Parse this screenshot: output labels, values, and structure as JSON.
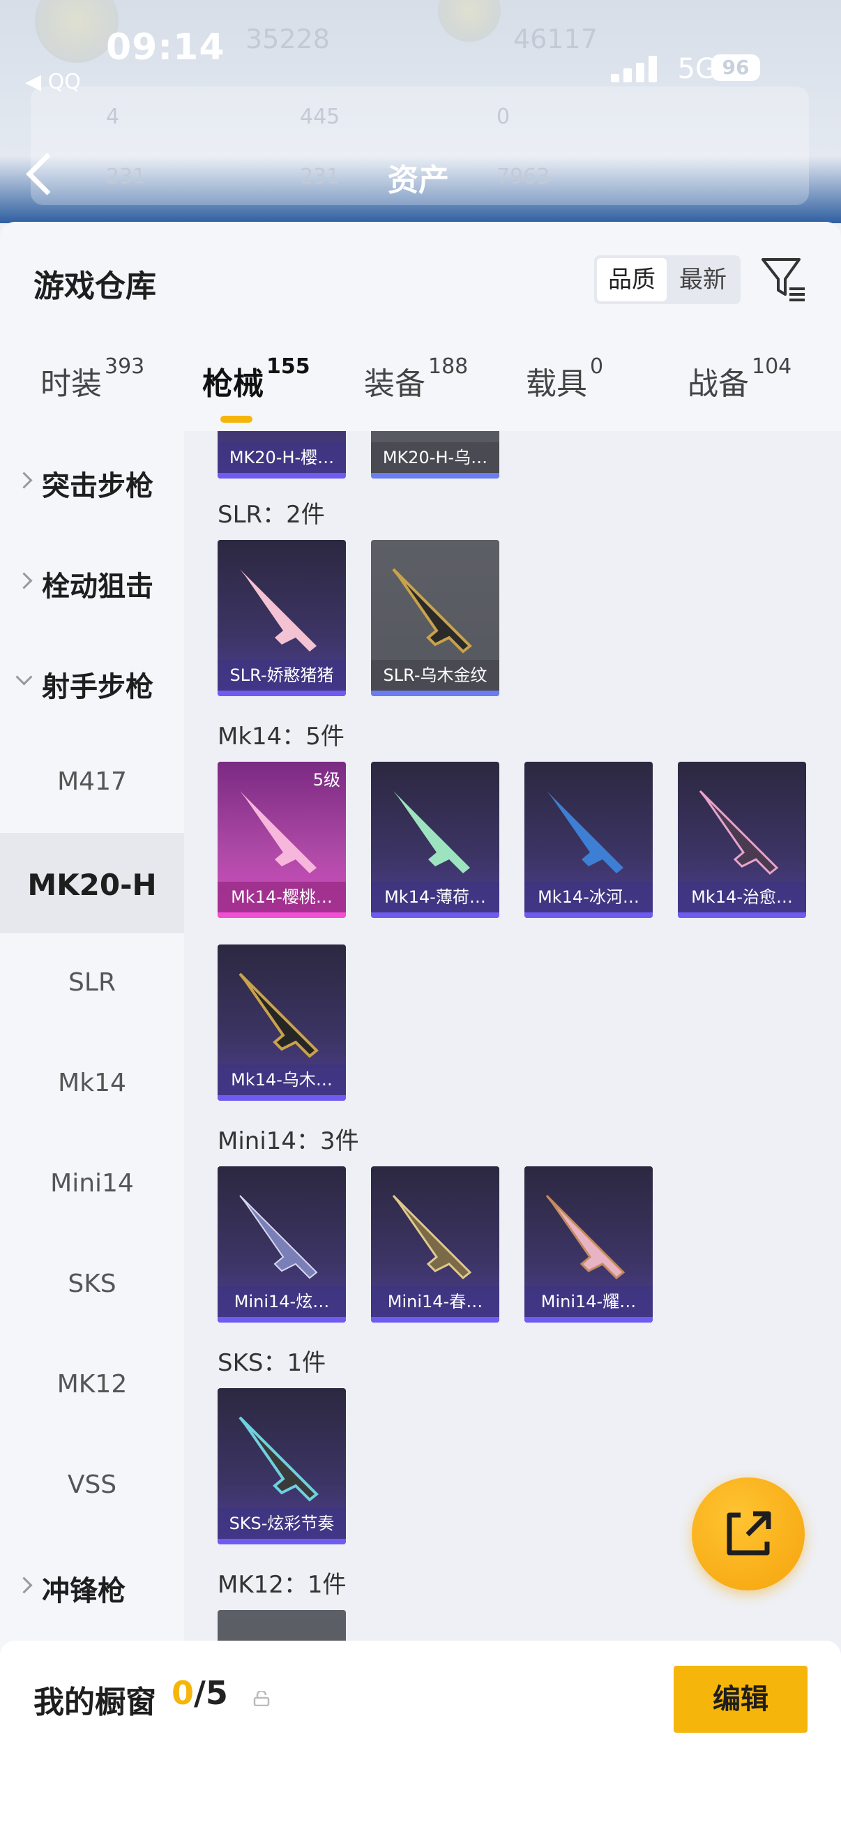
{
  "status_bar": {
    "time": "09:14",
    "back_app": "◀ QQ",
    "network": "5G",
    "battery": "96"
  },
  "header": {
    "title": "资产",
    "blurred_stats": [
      "4",
      "445",
      "0",
      "231",
      "7963"
    ],
    "top_numbers": [
      "35228",
      "46117"
    ]
  },
  "sheet": {
    "title": "游戏仓库",
    "sort": {
      "quality": "品质",
      "latest": "最新"
    }
  },
  "tabs": [
    {
      "label": "时装",
      "count": "393"
    },
    {
      "label": "枪械",
      "count": "155"
    },
    {
      "label": "装备",
      "count": "188"
    },
    {
      "label": "载具",
      "count": "0"
    },
    {
      "label": "战备",
      "count": "104"
    }
  ],
  "sidebar": {
    "items": [
      {
        "label": "突击步枪"
      },
      {
        "label": "栓动狙击"
      },
      {
        "label": "射手步枪"
      },
      {
        "label": "M417"
      },
      {
        "label": "MK20-H"
      },
      {
        "label": "SLR"
      },
      {
        "label": "Mk14"
      },
      {
        "label": "Mini14"
      },
      {
        "label": "SKS"
      },
      {
        "label": "MK12"
      },
      {
        "label": "VSS"
      },
      {
        "label": "冲锋枪"
      }
    ]
  },
  "content": {
    "top_row": [
      "MK20-H-樱…",
      "MK20-H-乌…"
    ],
    "sections": [
      {
        "header": "SLR：2件",
        "items": [
          "SLR-娇憨猪猪",
          "SLR-乌木金纹"
        ]
      },
      {
        "header": "Mk14：5件",
        "items": [
          "Mk14-樱桃…",
          "Mk14-薄荷…",
          "Mk14-冰河…",
          "Mk14-治愈…",
          "Mk14-乌木…"
        ],
        "first_level": "5级"
      },
      {
        "header": "Mini14：3件",
        "items": [
          "Mini14-炫…",
          "Mini14-春…",
          "Mini14-耀…"
        ]
      },
      {
        "header": "SKS：1件",
        "items": [
          "SKS-炫彩节奏"
        ]
      },
      {
        "header": "MK12：1件"
      }
    ]
  },
  "bottom": {
    "label": "我的橱窗",
    "current": "0",
    "total": "/5",
    "edit": "编辑"
  },
  "colors": {
    "accent": "#f5b50a",
    "card_purple": "#3c3464",
    "card_pink": "#c44db6"
  }
}
